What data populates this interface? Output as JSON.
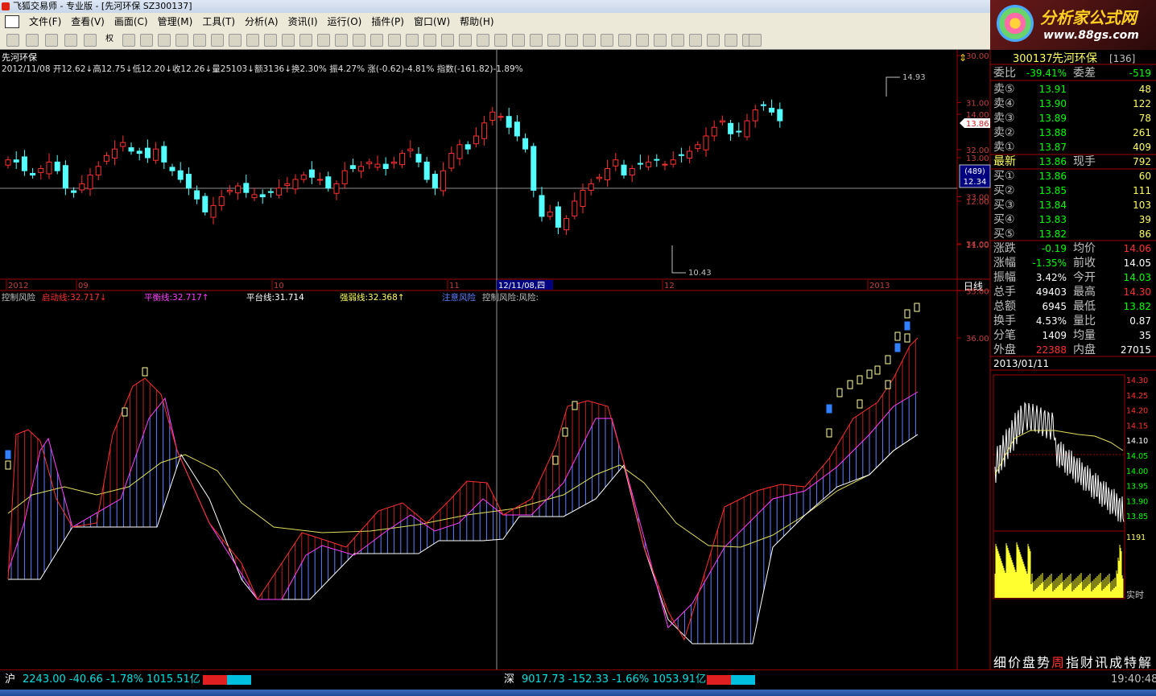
{
  "window": {
    "title": "飞狐交易师 - 专业版 - [先河环保 SZ300137]"
  },
  "menu": [
    "文件(F)",
    "查看(V)",
    "画面(C)",
    "管理(M)",
    "工具(T)",
    "分析(A)",
    "资讯(I)",
    "运行(O)",
    "插件(P)",
    "窗口(W)",
    "帮助(H)"
  ],
  "toolbar": {
    "quan_label": "权"
  },
  "banner": {
    "title": "分析家公式网",
    "url": "www.88gs.com"
  },
  "main": {
    "stock_name": "先河环保",
    "info_line": "2012/11/08 开12.62↓高12.75↓低12.20↓收12.26↓量25103↓额3136↓换2.30% 振4.27% 涨(-0.62)-4.81% 指数(-161.82)-1.89%",
    "high_label": "14.93",
    "low_label": "10.43",
    "current_price_tag": "13.86",
    "cursor_count": "(489)",
    "cursor_price": "12.34",
    "price_axis": [
      "14.00",
      "13.00",
      "12.00",
      "11.00"
    ],
    "date_labels": [
      "2012",
      "09",
      "10",
      "11",
      "12/11/08,四",
      "12",
      "2013"
    ],
    "period": "日线"
  },
  "indicator": {
    "legend": [
      {
        "text": "控制风险",
        "color": "#c0c0c0"
      },
      {
        "text": "启动线:32.717↓",
        "color": "#ff3030"
      },
      {
        "text": "平衡线:32.717↑",
        "color": "#ff40ff"
      },
      {
        "text": "平台线:31.714",
        "color": "#ffffff"
      },
      {
        "text": "强弱线:32.368↑",
        "color": "#ffff60"
      },
      {
        "text": "注意风险",
        "color": "#6080ff"
      },
      {
        "text": "控制风险:风险:",
        "color": "#c0c0c0"
      }
    ],
    "axis": [
      "36.00",
      "35.00",
      "34.00",
      "33.00",
      "32.00",
      "31.00",
      "30.00"
    ]
  },
  "panel": {
    "code": "300137",
    "name": "先河环保",
    "num": "[136]",
    "weibi_label": "委比",
    "weibi": "-39.41%",
    "weicha_label": "委差",
    "weicha": "-519",
    "sells": [
      {
        "label": "卖⑤",
        "price": "13.91",
        "vol": "48"
      },
      {
        "label": "卖④",
        "price": "13.90",
        "vol": "122"
      },
      {
        "label": "卖③",
        "price": "13.89",
        "vol": "78"
      },
      {
        "label": "卖②",
        "price": "13.88",
        "vol": "261"
      },
      {
        "label": "卖①",
        "price": "13.87",
        "vol": "409"
      }
    ],
    "latest_label": "最新",
    "latest": "13.86",
    "xianshou_label": "现手",
    "xianshou": "792",
    "buys": [
      {
        "label": "买①",
        "price": "13.86",
        "vol": "60"
      },
      {
        "label": "买②",
        "price": "13.85",
        "vol": "111"
      },
      {
        "label": "买③",
        "price": "13.84",
        "vol": "103"
      },
      {
        "label": "买④",
        "price": "13.83",
        "vol": "39"
      },
      {
        "label": "买⑤",
        "price": "13.82",
        "vol": "86"
      }
    ],
    "stats": [
      {
        "l1": "涨跌",
        "v1": "-0.19",
        "c1": "#00ff00",
        "l2": "均价",
        "v2": "14.06",
        "c2": "#ff3030"
      },
      {
        "l1": "涨幅",
        "v1": "-1.35%",
        "c1": "#00ff00",
        "l2": "前收",
        "v2": "14.05",
        "c2": "#ffffff"
      },
      {
        "l1": "振幅",
        "v1": "3.42%",
        "c1": "#ffffff",
        "l2": "今开",
        "v2": "14.03",
        "c2": "#00ff00"
      },
      {
        "l1": "总手",
        "v1": "49403",
        "c1": "#ffffff",
        "l2": "最高",
        "v2": "14.30",
        "c2": "#ff3030"
      },
      {
        "l1": "总额",
        "v1": "6945",
        "c1": "#ffffff",
        "l2": "最低",
        "v2": "13.82",
        "c2": "#00ff00"
      },
      {
        "l1": "换手",
        "v1": "4.53%",
        "c1": "#ffffff",
        "l2": "量比",
        "v2": "0.87",
        "c2": "#ffffff"
      },
      {
        "l1": "分笔",
        "v1": "1409",
        "c1": "#ffffff",
        "l2": "均量",
        "v2": "35",
        "c2": "#ffffff"
      },
      {
        "l1": "外盘",
        "v1": "22388",
        "c1": "#ff3030",
        "l2": "内盘",
        "v2": "27015",
        "c2": "#ffffff"
      }
    ],
    "mini_date": "2013/01/11",
    "mini_axis": [
      "14.30",
      "14.25",
      "14.20",
      "14.15",
      "14.10",
      "14.05",
      "14.00",
      "13.95",
      "13.90",
      "13.85"
    ],
    "mini_vol": "1191",
    "mini_mode": "实时",
    "tabs": [
      "细",
      "价",
      "盘",
      "势",
      "周",
      "指",
      "财",
      "讯",
      "成",
      "特",
      "解"
    ]
  },
  "status": {
    "sh_label": "沪",
    "sh_value": "2243.00 -40.66 -1.78% 1015.51亿",
    "sz_label": "深",
    "sz_value": "9017.73 -152.33 -1.66% 1053.91亿",
    "time": "19:40:48"
  }
}
